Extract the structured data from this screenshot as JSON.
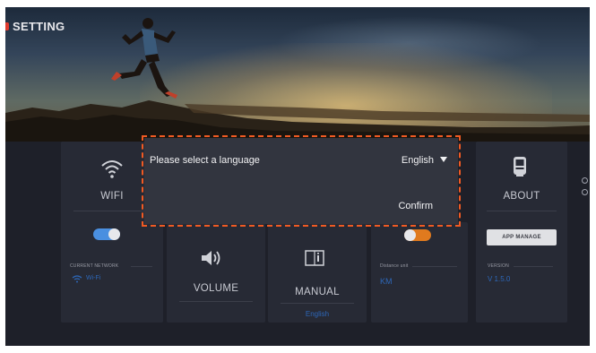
{
  "header": {
    "title": "SETTING"
  },
  "cards": {
    "wifi": {
      "label": "WIFI",
      "toggle_state": "on",
      "current_network_label": "CURRENT NETWORK",
      "network_value": "Wi-Fi"
    },
    "volume": {
      "label": "VOLUME"
    },
    "manual": {
      "label": "MANUAL",
      "language_value": "English"
    },
    "distance": {
      "toggle_state": "off",
      "distance_unit_label": "Distance unit",
      "unit_value": "KM"
    },
    "about": {
      "label": "ABOUT",
      "app_manage_label": "APP MANAGE",
      "version_label": "VERSION",
      "version_value": "V 1.5.0"
    }
  },
  "dialog": {
    "prompt": "Please select a language",
    "selected_language": "English",
    "confirm_label": "Confirm"
  },
  "colors": {
    "accent_blue": "#2d67b8",
    "toggle_on": "#4a8fe0",
    "toggle_off": "#e07a1e",
    "highlight_dashed": "#f05a23",
    "title_marker": "#e03a2e"
  }
}
